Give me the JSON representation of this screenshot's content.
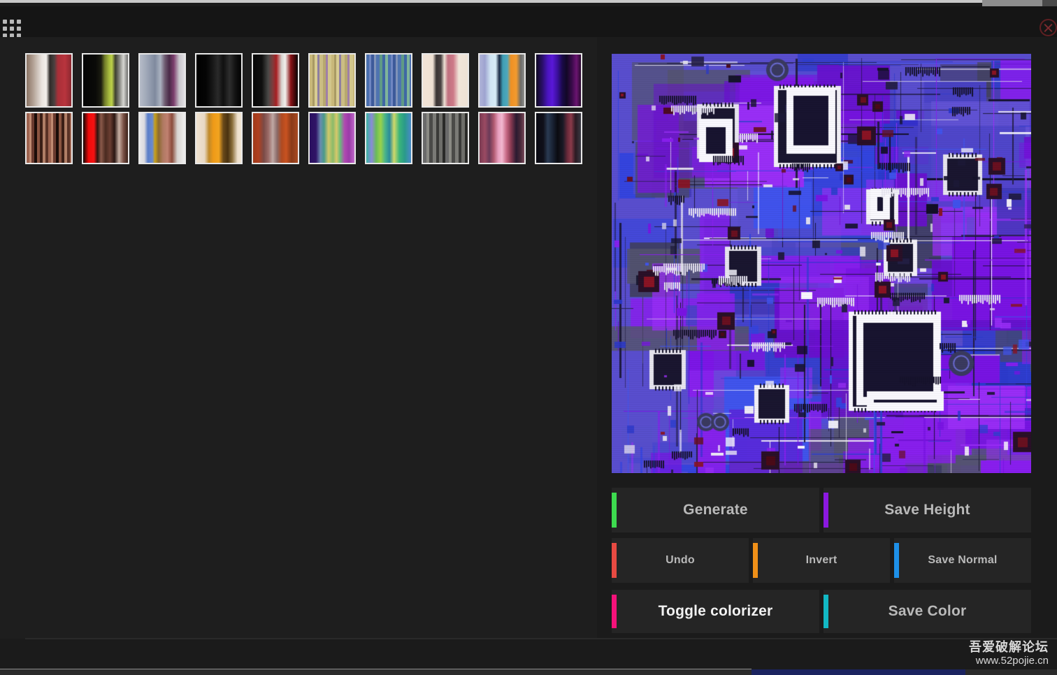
{
  "window": {
    "grip_icon": "drag-grip-icon",
    "close_icon": "close-circle-icon"
  },
  "palette": {
    "label": "gradient-palette-grid",
    "rows": [
      {
        "swatches": [
          {
            "name": "gradient-swatch-1",
            "gradient": "linear-gradient(90deg,#8a7465 0%,#b09e91 14%,#e9e4df 34%,#f3f0ec 44%,#2e2a28 52%,#4a4140 62%,#a82f38 70%,#b8343d 86%,#8c2830 100%)"
          },
          {
            "name": "gradient-swatch-2",
            "gradient": "linear-gradient(90deg,#050505 0%,#0a0a08 28%,#1b1c10 40%,#6f7a28 48%,#a7bb3e 58%,#bdd24a 64%,#3d3f30 72%,#8f8f8a 82%,#d6d6d2 90%,#6e6e6c 100%)"
          },
          {
            "name": "gradient-swatch-3",
            "gradient": "linear-gradient(90deg,#b6bcc8 0%,#9aa3b4 18%,#7f8a9e 34%,#aab2c0 46%,#6e5b70 56%,#4a2a48 66%,#7d3f6e 76%,#c9c6cc 88%,#e2e0e4 100%)"
          },
          {
            "name": "gradient-swatch-4",
            "gradient": "linear-gradient(90deg,#000000 0%,#050505 22%,#1a1a1a 38%,#2a2a2a 48%,#101010 60%,#2e2e2e 74%,#141414 86%,#000000 100%)"
          },
          {
            "name": "gradient-swatch-5",
            "gradient": "linear-gradient(90deg,#060606 0%,#101010 20%,#4a4a48 34%,#7e3c3c 44%,#a81f22 52%,#d8d4d0 64%,#f2efec 72%,#8a1418 84%,#3a0608 94%,#0a0a0a 100%)"
          },
          {
            "name": "gradient-swatch-6",
            "gradient": "repeating-linear-gradient(90deg,#c8b87a 0px,#c8b87a 4px,#a99a64 4px,#a99a64 7px,#d8cc92 7px,#d8cc92 11px,#8e7fa0 11px,#8e7fa0 14px,#cbbd84 14px,#cbbd84 19px,#b7a86e 19px,#b7a86e 23px,#a07fa8 23px,#a07fa8 26px,#d2c68c 26px,#d2c68c 31px)"
          },
          {
            "name": "gradient-swatch-7",
            "gradient": "repeating-linear-gradient(90deg,#4a6fae 0px,#4a6fae 4px,#6f86c2 4px,#6f86c2 7px,#3d5a9a 7px,#3d5a9a 11px,#7f92b8 11px,#7f92b8 14px,#4f74b0 14px,#4f74b0 19px,#5f9a86 19px,#5f9a86 23px,#3f67a4 23px,#3f67a4 27px,#7fb49a 27px,#7fb49a 31px)"
          },
          {
            "name": "gradient-swatch-8",
            "gradient": "linear-gradient(90deg,#f0e2d6 0%,#efe1d4 22%,#3a3434 30%,#4a4242 40%,#ece0d4 48%,#c0707f 56%,#cd7a88 68%,#f0e4d8 80%,#eee2d6 100%)"
          },
          {
            "name": "gradient-swatch-9",
            "gradient": "linear-gradient(90deg,#b0b4d8 0%,#9ea4d0 12%,#cfe4f2 24%,#d6ecf6 36%,#1a2a44 44%,#3f9eb4 52%,#4fa8bc 62%,#ef9024 70%,#f29a2e 82%,#6a6a68 92%,#8f8f8c 100%)"
          },
          {
            "name": "gradient-swatch-10",
            "gradient": "linear-gradient(90deg,#100a22 0%,#2a0f6a 14%,#4a14c0 26%,#5a18d8 36%,#3a0f9a 48%,#1a0a4a 58%,#120826 68%,#3a0a4a 80%,#6a1470 90%,#2a0a30 100%)"
          }
        ]
      },
      {
        "swatches": [
          {
            "name": "gradient-swatch-11",
            "gradient": "repeating-linear-gradient(90deg,#9e6450 0px,#9e6450 4px,#c08a72 4px,#c08a72 7px,#6a3a2e 7px,#6a3a2e 11px,#1a0c08 11px,#1a0c08 15px,#8a5440 15px,#8a5440 19px,#3a1e16 19px,#3a1e16 23px,#b07e66 23px,#b07e66 27px,#5a3226 27px,#5a3226 31px)"
          },
          {
            "name": "gradient-swatch-12",
            "gradient": "linear-gradient(90deg,#0a0605 0%,#f00a0a 12%,#f41212 24%,#2a1410 32%,#8a5a4a 40%,#4a2a20 50%,#6a3e32 60%,#2a1612 70%,#c8b0a4 80%,#7a5246 90%,#3a2018 100%)"
          },
          {
            "name": "gradient-swatch-13",
            "gradient": "linear-gradient(90deg,#e8e8ea 0%,#dadade 10%,#5a7ec8 18%,#6a8ad0 28%,#c8a01a 34%,#8a6a30 42%,#b07a62 52%,#c08070 62%,#8a4a3a 72%,#d8d4d0 84%,#eeeeee 100%)"
          },
          {
            "name": "gradient-swatch-14",
            "gradient": "linear-gradient(90deg,#efe2d0 0%,#e8d8c4 18%,#c08a2a 28%,#ef9a18 38%,#f2a420 50%,#6a4a1a 60%,#4a3210 70%,#8a6e3a 80%,#eee0cc 92%,#f2e6d4 100%)"
          },
          {
            "name": "gradient-swatch-15",
            "gradient": "linear-gradient(90deg,#a03a1a 0%,#b04020 12%,#7a4a46 24%,#9a6a66 34%,#c0a8a4 44%,#8a6a68 54%,#b04a20 64%,#c85220 74%,#8a3a18 86%,#a84a22 100%)"
          },
          {
            "name": "gradient-swatch-16",
            "gradient": "linear-gradient(90deg,#2a1060 0%,#301466 14%,#6a8ab0 24%,#4a9a8a 32%,#cfc86a 42%,#8aba6a 52%,#d8c86a 60%,#6abb7a 68%,#b04ab0 78%,#9a3aa8 88%,#c06ac8 100%)"
          },
          {
            "name": "gradient-swatch-17",
            "gradient": "linear-gradient(90deg,#3ab4a0 0%,#8a8ad8 12%,#6abb5a 22%,#9ad24a 32%,#4ab48a 42%,#2a8a9a 52%,#cfd86a 62%,#3ab47a 74%,#2a9a8a 86%,#4a8ac8 100%)"
          },
          {
            "name": "gradient-swatch-18",
            "gradient": "repeating-linear-gradient(90deg,#6a6a6a 0px,#6a6a6a 5px,#8a8a84 5px,#8a8a84 9px,#4a4a48 9px,#4a4a48 14px,#7a7a76 14px,#7a7a76 19px,#3a3a38 19px,#3a3a38 23px,#6e6e6a 23px,#6e6e6a 28px,#2a2a28 28px,#2a2a28 32px)"
          },
          {
            "name": "gradient-swatch-19",
            "gradient": "linear-gradient(90deg,#7a3a52 0%,#9a4a62 12%,#6a3a58 22%,#b05a70 32%,#e8a0c0 42%,#f2b8d0 50%,#c86a86 60%,#8a3a52 70%,#2a1a30 82%,#4a2a3a 92%,#7a4a5a 100%)"
          },
          {
            "name": "gradient-swatch-20",
            "gradient": "linear-gradient(90deg,#0a0a12 0%,#10101a 16%,#2a3a52 26%,#1a2436 36%,#0a0a10 48%,#1a1a26 60%,#6a2a3a 70%,#8a3a4a 78%,#2a1a22 88%,#3a3a44 100%)"
          }
        ]
      }
    ]
  },
  "preview": {
    "name": "texture-preview",
    "description": "circuit-board texture colorized purple-blue"
  },
  "buttons": {
    "row1": [
      {
        "label": "Generate",
        "accent": "#3ddb4f",
        "name": "generate-button",
        "bright": false
      },
      {
        "label": "Save Height",
        "accent": "#8b18e0",
        "name": "save-height-button",
        "bright": false
      }
    ],
    "row2": [
      {
        "label": "Undo",
        "accent": "#e84a42",
        "name": "undo-button",
        "bright": false
      },
      {
        "label": "Invert",
        "accent": "#f09018",
        "name": "invert-button",
        "bright": false
      },
      {
        "label": "Save Normal",
        "accent": "#1e90e8",
        "name": "save-normal-button",
        "bright": false
      }
    ],
    "row3": [
      {
        "label": "Toggle colorizer",
        "accent": "#f5127a",
        "name": "toggle-colorizer-button",
        "bright": true
      },
      {
        "label": "Save Color",
        "accent": "#12b8c4",
        "name": "save-color-button",
        "bright": false
      }
    ]
  },
  "watermark": {
    "cn": "吾爱破解论坛",
    "url": "www.52pojie.cn"
  }
}
